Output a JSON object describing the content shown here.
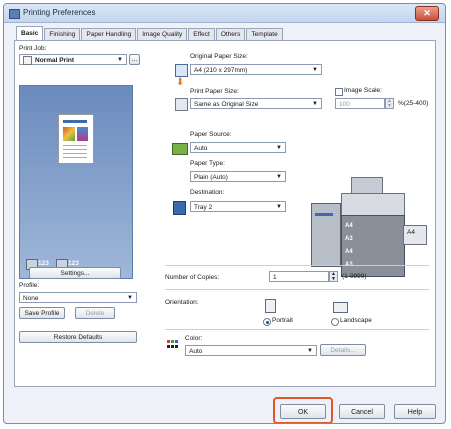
{
  "window": {
    "title": "Printing Preferences",
    "close_glyph": "✕"
  },
  "tabs": [
    "Basic",
    "Finishing",
    "Paper Handling",
    "Image Quality",
    "Effect",
    "Others",
    "Template"
  ],
  "left": {
    "print_job_label": "Print Job:",
    "print_job_value": "Normal Print",
    "more_button": "...",
    "tray_a_value": "123",
    "tray_b_value": "123",
    "settings_button": "Settings...",
    "profile_label": "Profile:",
    "profile_value": "None",
    "save_profile_button": "Save Profile",
    "delete_button": "Delete",
    "restore_defaults_button": "Restore Defaults"
  },
  "right": {
    "original_paper_size_label": "Original Paper Size:",
    "original_paper_size_value": "A4 (210 x 297mm)",
    "print_paper_size_label": "Print Paper Size:",
    "print_paper_size_value": "Same as Original Size",
    "image_scale_label": "Image Scale:",
    "image_scale_value": "100",
    "image_scale_range": "%(25-400)",
    "paper_source_label": "Paper Source:",
    "paper_source_value": "Auto",
    "paper_type_label": "Paper Type:",
    "paper_type_value": "Plain (Auto)",
    "destination_label": "Destination:",
    "destination_value": "Tray 2",
    "printer_trays": [
      "A4",
      "A3",
      "A4",
      "A3"
    ],
    "printer_side_tray": "A4",
    "copies_label": "Number of Copies:",
    "copies_value": "1",
    "copies_range": "(1-9999)",
    "orientation_label": "Orientation:",
    "portrait_label": "Portrait",
    "landscape_label": "Landscape",
    "color_label": "Color:",
    "color_value": "Auto",
    "details_button": "Details..."
  },
  "footer": {
    "ok": "OK",
    "cancel": "Cancel",
    "help": "Help"
  }
}
